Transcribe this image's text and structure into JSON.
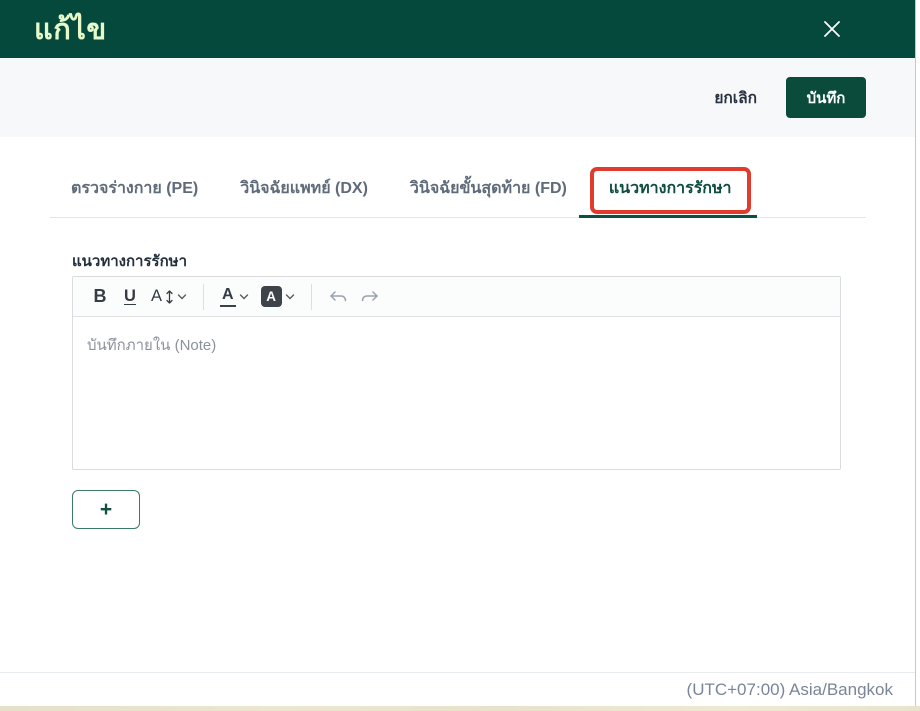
{
  "modal": {
    "title": "แก้ไข"
  },
  "actions": {
    "cancel_label": "ยกเลิก",
    "save_label": "บันทึก"
  },
  "tabs": [
    {
      "label": "ตรวจร่างกาย (PE)",
      "active": false
    },
    {
      "label": "วินิจฉัยแพทย์ (DX)",
      "active": false
    },
    {
      "label": "วินิจฉัยขั้นสุดท้าย (FD)",
      "active": false
    },
    {
      "label": "แนวทางการรักษา",
      "active": true,
      "annotated": true
    }
  ],
  "editor": {
    "label": "แนวทางการรักษา",
    "placeholder": "บันทึกภายใน (Note)",
    "toolbar": {
      "bold_label": "B",
      "underline_label": "U",
      "font_size_label": "A",
      "text_color_label": "A",
      "highlight_label": "A"
    }
  },
  "add_button_label": "+",
  "footer": {
    "timezone": "(UTC+07:00) Asia/Bangkok"
  },
  "colors": {
    "header_green": "#05493d",
    "title_text": "#e6f9cb",
    "save_button_green": "#0a4b3c",
    "active_tab_green": "#0e4d40",
    "annotation_red": "#e13b2e",
    "action_bar_bg": "#f7f8fa",
    "bottom_strip_beige": "#e9e2cb"
  }
}
